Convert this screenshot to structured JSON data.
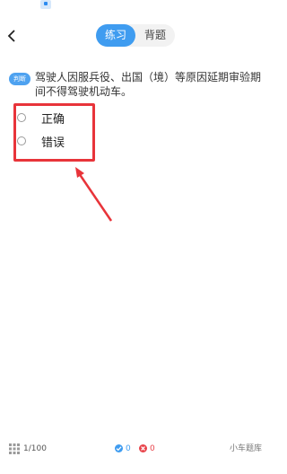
{
  "header": {
    "tabs": [
      {
        "label": "练习",
        "active": true
      },
      {
        "label": "背题",
        "active": false
      }
    ]
  },
  "question": {
    "type_tag": "判断",
    "text": "驾驶人因服兵役、出国（境）等原因延期审验期间不得驾驶机动车。",
    "options": [
      "正确",
      "错误"
    ]
  },
  "footer": {
    "progress": "1/100",
    "correct_count": "0",
    "wrong_count": "0",
    "brand": "小车题库"
  },
  "colors": {
    "accent": "#3f9cf0",
    "highlight": "#e8343a",
    "error": "#e8434a"
  },
  "icons": [
    "app-status-icon",
    "back-chevron-icon",
    "answer-sheet-grid-icon",
    "correct-check-icon",
    "wrong-x-icon",
    "annotation-arrow"
  ]
}
